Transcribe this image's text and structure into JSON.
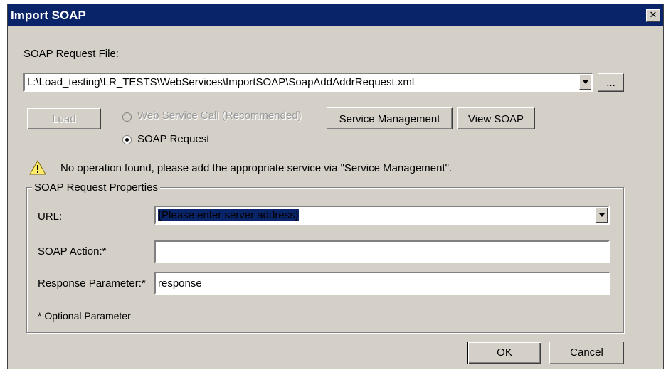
{
  "window": {
    "title": "Import SOAP",
    "close_glyph": "✕"
  },
  "soap_request_file": {
    "label": "SOAP Request File:",
    "value": "L:\\Load_testing\\LR_TESTS\\WebServices\\ImportSOAP\\SoapAddAddrRequest.xml",
    "browse_label": "..."
  },
  "actions": {
    "load_label": "Load",
    "web_service_call_label": "Web Service Call (Recommended)",
    "soap_request_label": "SOAP Request",
    "service_management_label": "Service Management",
    "view_soap_label": "View SOAP"
  },
  "warning": {
    "icon": "warning-icon",
    "text": "No operation found, please add the appropriate service via \"Service Management\"."
  },
  "properties": {
    "title": "SOAP Request Properties",
    "url_label": "URL:",
    "url_value": "{Please enter server address}",
    "soap_action_label": "SOAP Action:*",
    "soap_action_value": "",
    "response_param_label": "Response Parameter:*",
    "response_param_value": "response",
    "optional_note": "* Optional Parameter"
  },
  "footer": {
    "ok_label": "OK",
    "cancel_label": "Cancel"
  },
  "colors": {
    "titlebar": "#0a246a",
    "dialog_bg": "#d4d0c8",
    "selection": "#0a246a"
  }
}
